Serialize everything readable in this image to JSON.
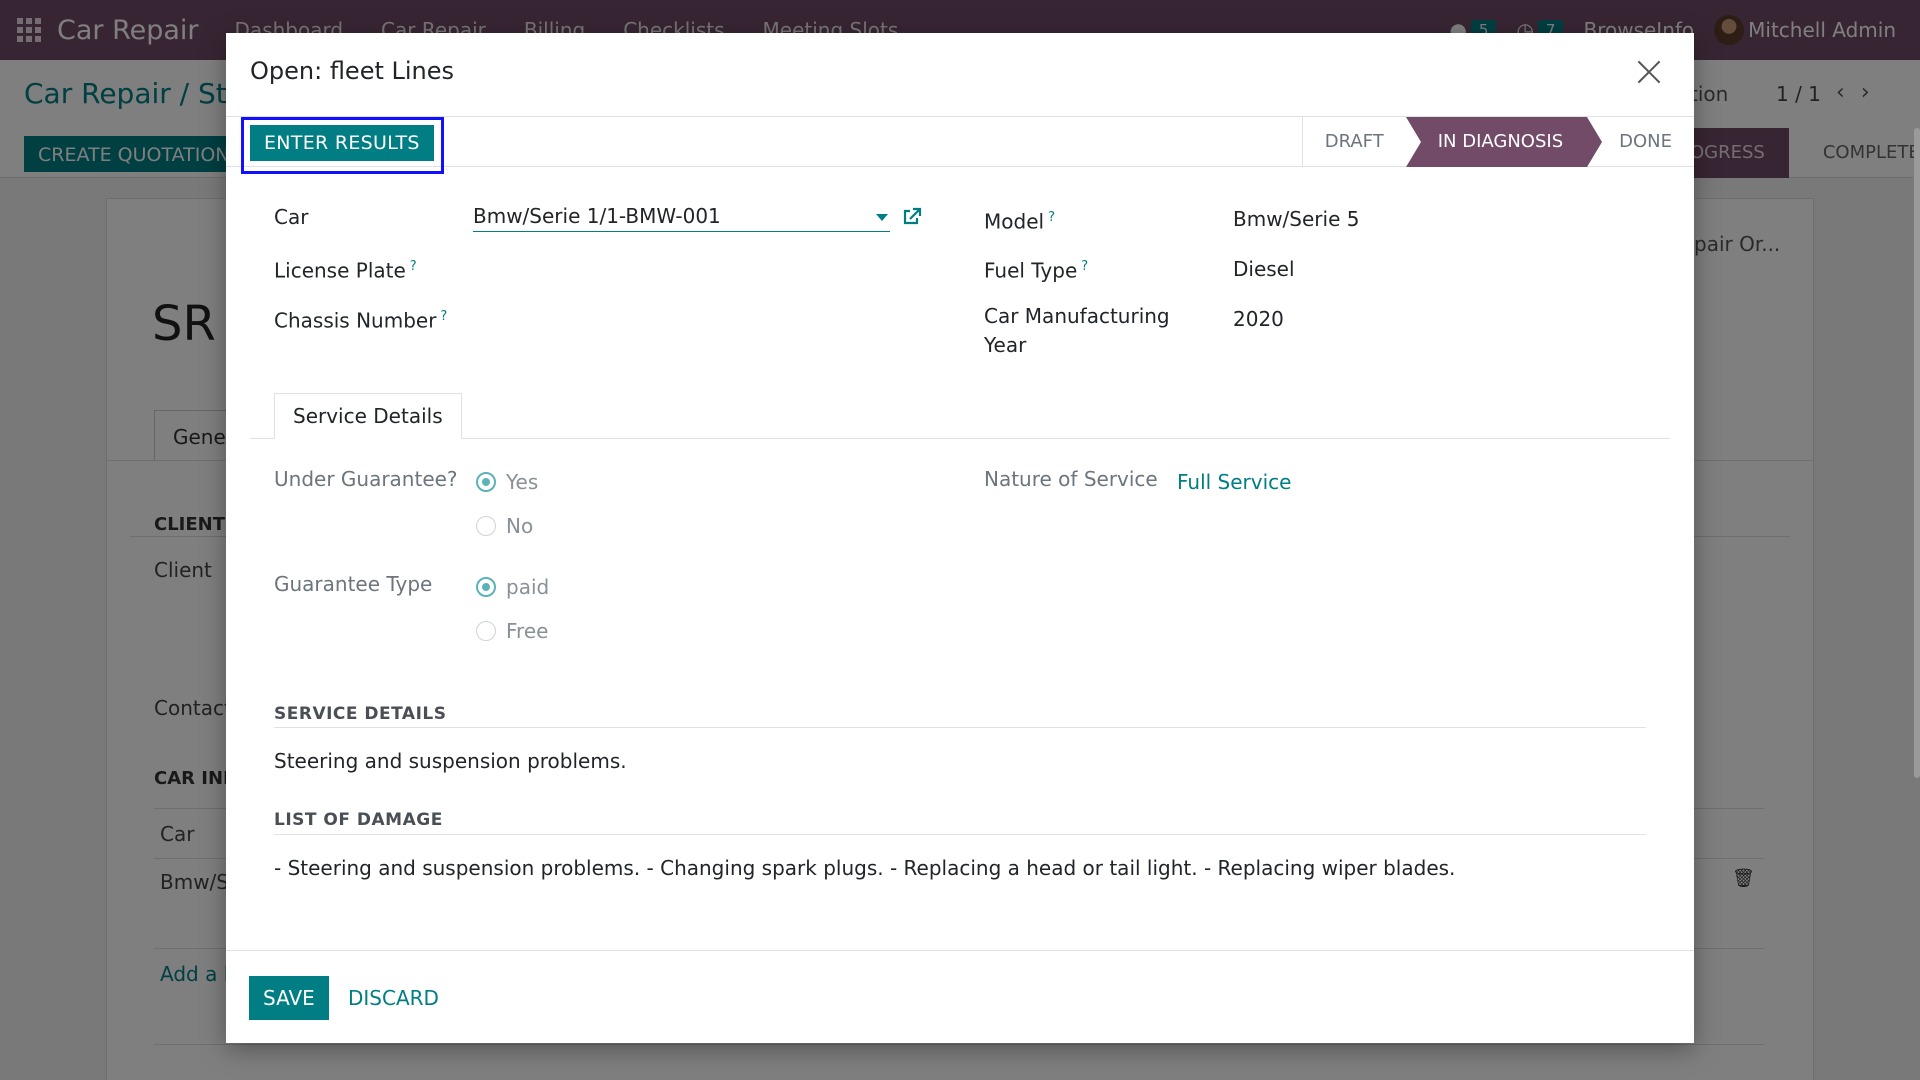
{
  "navbar": {
    "brand": "Car Repair",
    "menu": [
      "Dashboard",
      "Car Repair",
      "Billing",
      "Checklists",
      "Meeting Slots"
    ],
    "messages_count": "5",
    "activities_count": "7",
    "company": "BrowseInfo",
    "user": "Mitchell Admin"
  },
  "background": {
    "breadcrumb": "Car Repair / Ste",
    "pager": "1 / 1",
    "action_right": "tion",
    "create_button": "CREATE QUOTATION",
    "status_in_progress": "OGRESS",
    "status_complete": "COMPLETE",
    "ref": "pair Or...",
    "title": "SR",
    "tab_general": "Gene",
    "section_client": "CLIENT",
    "label_client": "Client",
    "label_contact": "Contact",
    "section_car_info": "CAR INF",
    "col_car": "Car",
    "row_car": "Bmw/S",
    "add_line": "Add a l"
  },
  "modal": {
    "title": "Open: fleet Lines",
    "enter_results": "ENTER RESULTS",
    "stages": [
      "DRAFT",
      "IN DIAGNOSIS",
      "DONE"
    ],
    "active_stage": "IN DIAGNOSIS",
    "fields": {
      "car_label": "Car",
      "car_value": "Bmw/Serie 1/1-BMW-001",
      "license_plate_label": "License Plate",
      "chassis_label": "Chassis Number",
      "model_label": "Model",
      "model_value": "Bmw/Serie 5",
      "fuel_label": "Fuel Type",
      "fuel_value": "Diesel",
      "year_label_1": "Car Manufacturing",
      "year_label_2": "Year",
      "year_value": "2020"
    },
    "tab": "Service Details",
    "guarantee_label": "Under Guarantee?",
    "guarantee_options": [
      "Yes",
      "No"
    ],
    "guarantee_selected": "Yes",
    "guarantee_type_label": "Guarantee Type",
    "guarantee_type_options": [
      "paid",
      "Free"
    ],
    "guarantee_type_selected": "paid",
    "nature_label": "Nature of Service",
    "nature_value": "Full Service",
    "service_details_title": "SERVICE DETAILS",
    "service_details_text": "Steering and suspension problems.",
    "damage_title": "LIST OF DAMAGE",
    "damage_text": "- Steering and suspension problems. - Changing spark plugs. - Replacing a head or tail light. - Replacing wiper blades.",
    "save": "SAVE",
    "discard": "DISCARD",
    "help_mark": "?"
  },
  "colors": {
    "brand_purple": "#714b67",
    "accent_teal": "#017e84",
    "highlight_blue": "#1010ff"
  }
}
